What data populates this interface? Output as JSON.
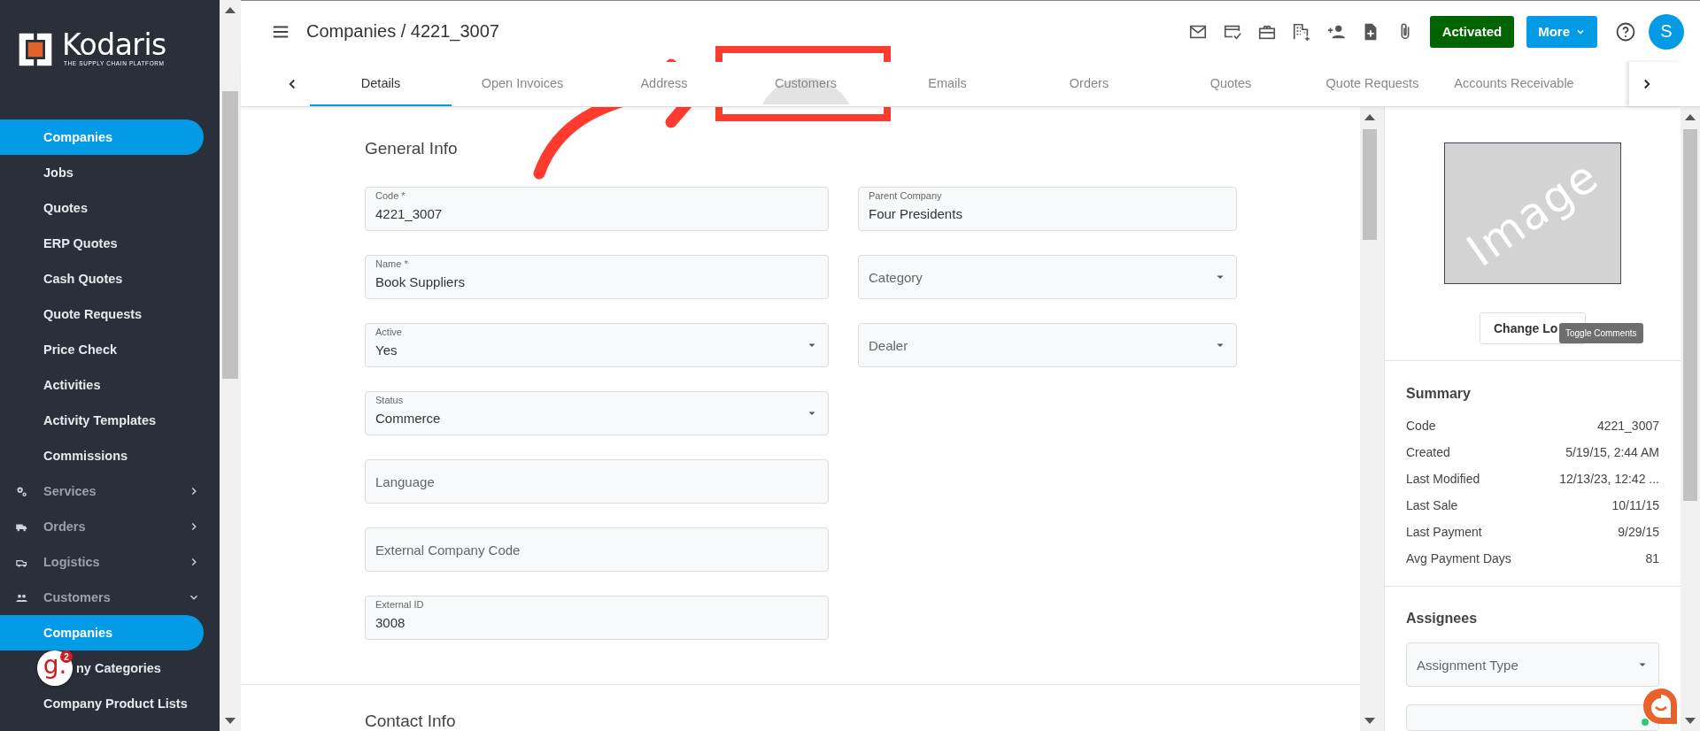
{
  "sidebar": {
    "logo": {
      "name": "Kodaris",
      "tagline": "THE SUPPLY CHAIN PLATFORM"
    },
    "items": [
      {
        "label": "Companies",
        "kind": "link",
        "selected": true
      },
      {
        "label": "Jobs",
        "kind": "link",
        "selected": false
      },
      {
        "label": "Quotes",
        "kind": "link",
        "selected": false
      },
      {
        "label": "ERP Quotes",
        "kind": "link",
        "selected": false
      },
      {
        "label": "Cash Quotes",
        "kind": "link",
        "selected": false
      },
      {
        "label": "Quote Requests",
        "kind": "link",
        "selected": false
      },
      {
        "label": "Price Check",
        "kind": "link",
        "selected": false
      },
      {
        "label": "Activities",
        "kind": "link",
        "selected": false
      },
      {
        "label": "Activity Templates",
        "kind": "link",
        "selected": false
      },
      {
        "label": "Commissions",
        "kind": "link",
        "selected": false
      },
      {
        "label": "Services",
        "kind": "group",
        "expanded": false
      },
      {
        "label": "Orders",
        "kind": "group",
        "expanded": false
      },
      {
        "label": "Logistics",
        "kind": "group",
        "expanded": false
      },
      {
        "label": "Customers",
        "kind": "group",
        "expanded": true,
        "children": [
          {
            "label": "Companies",
            "kind": "link",
            "selected": true
          },
          {
            "label": "ny Categories",
            "kind": "link",
            "selected": false,
            "widget": {
              "letter": "g.",
              "badge": "2"
            }
          },
          {
            "label": "Company Product Lists",
            "kind": "link",
            "selected": false
          }
        ]
      }
    ]
  },
  "header": {
    "title": "Companies / 4221_3007",
    "status_button": "Activated",
    "more_button": "More",
    "avatar": "S"
  },
  "tabs": [
    {
      "label": "Details",
      "selected": true,
      "hovered": false
    },
    {
      "label": "Open Invoices",
      "selected": false,
      "hovered": false
    },
    {
      "label": "Address",
      "selected": false,
      "hovered": false
    },
    {
      "label": "Customers",
      "selected": false,
      "hovered": true
    },
    {
      "label": "Emails",
      "selected": false,
      "hovered": false
    },
    {
      "label": "Orders",
      "selected": false,
      "hovered": false
    },
    {
      "label": "Quotes",
      "selected": false,
      "hovered": false
    },
    {
      "label": "Quote Requests",
      "selected": false,
      "hovered": false
    },
    {
      "label": "Accounts Receivable",
      "selected": false,
      "hovered": false
    }
  ],
  "general_info": {
    "title": "General Info",
    "left_fields": [
      {
        "label": "Code *",
        "value": "4221_3007",
        "kind": "text"
      },
      {
        "label": "Name *",
        "value": "Book Suppliers",
        "kind": "text"
      },
      {
        "label": "Active",
        "value": "Yes",
        "kind": "select"
      },
      {
        "label": "Status",
        "value": "Commerce",
        "kind": "select"
      },
      {
        "placeholder": "Language",
        "kind": "text"
      },
      {
        "placeholder": "External Company Code",
        "kind": "text"
      },
      {
        "label": "External ID",
        "value": "3008",
        "kind": "text"
      }
    ],
    "right_fields": [
      {
        "label": "Parent Company",
        "value": "Four Presidents",
        "kind": "text"
      },
      {
        "placeholder": "Category",
        "kind": "select"
      },
      {
        "placeholder": "Dealer",
        "kind": "select"
      }
    ]
  },
  "next_section": {
    "title": "Contact Info"
  },
  "side_panel": {
    "logo_placeholder": "Image",
    "change_logo_button": "Change Lo",
    "tooltip": "Toggle Comments",
    "summary": {
      "title": "Summary",
      "rows": [
        {
          "label": "Code",
          "value": "4221_3007"
        },
        {
          "label": "Created",
          "value": "5/19/15, 2:44 AM"
        },
        {
          "label": "Last Modified",
          "value": "12/13/23, 12:42 ..."
        },
        {
          "label": "Last Sale",
          "value": "10/11/15"
        },
        {
          "label": "Last Payment",
          "value": "9/29/15"
        },
        {
          "label": "Avg Payment Days",
          "value": "81"
        }
      ]
    },
    "assignees": {
      "title": "Assignees",
      "fields": [
        {
          "placeholder": "Assignment Type",
          "kind": "select"
        }
      ]
    }
  }
}
